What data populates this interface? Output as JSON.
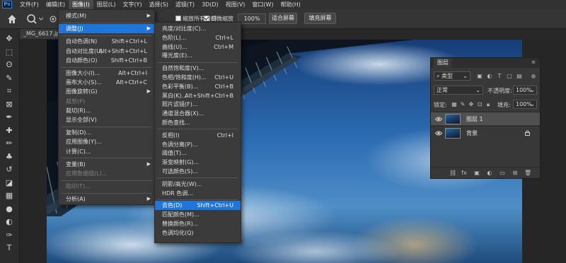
{
  "app": {
    "logo_text": "Ps"
  },
  "menubar": {
    "items": [
      "文件(F)",
      "编辑(E)",
      "图像(I)",
      "图层(L)",
      "文字(Y)",
      "选择(S)",
      "滤镜(T)",
      "3D(D)",
      "视图(V)",
      "窗口(W)",
      "帮助(H)"
    ],
    "active_index": 2
  },
  "options": {
    "resize_windows_label": "缩放所有窗口",
    "scrubby_zoom_label": "细微缩放",
    "zoom_value": "100%",
    "fit_screen_label": "适合屏幕",
    "fill_screen_label": "填充屏幕",
    "resize_windows_checked": false,
    "scrubby_zoom_checked": true
  },
  "document": {
    "tab_title": "_MG_6617.jpg"
  },
  "toolbar": {
    "icons": [
      "move-icon",
      "marquee-icon",
      "lasso-icon",
      "quick-select-icon",
      "crop-icon",
      "frame-icon",
      "eyedropper-icon",
      "healing-brush-icon",
      "brush-icon",
      "clone-stamp-icon",
      "history-brush-icon",
      "eraser-icon",
      "gradient-icon",
      "blur-icon",
      "dodge-icon",
      "pen-icon",
      "type-icon"
    ],
    "glyphs": [
      "✥",
      "⬚",
      "ʘ",
      "✎",
      "⌗",
      "⊠",
      "✒",
      "✚",
      "✏",
      "♣",
      "↺",
      "◪",
      "▦",
      "●",
      "◐",
      "✑",
      "T"
    ]
  },
  "image_menu": {
    "items": [
      {
        "label": "模式(M)",
        "shortcut": "",
        "submenu": true,
        "disabled": false
      },
      {
        "sep": true
      },
      {
        "label": "调整(J)",
        "shortcut": "",
        "submenu": true,
        "disabled": false,
        "highlight": true
      },
      {
        "sep": true
      },
      {
        "label": "自动色调(N)",
        "shortcut": "Shift+Ctrl+L",
        "disabled": false
      },
      {
        "label": "自动对比度(U)",
        "shortcut": "Alt+Shift+Ctrl+L",
        "disabled": false
      },
      {
        "label": "自动颜色(O)",
        "shortcut": "Shift+Ctrl+B",
        "disabled": false
      },
      {
        "sep": true
      },
      {
        "label": "图像大小(I)...",
        "shortcut": "Alt+Ctrl+I",
        "disabled": false
      },
      {
        "label": "画布大小(S)...",
        "shortcut": "Alt+Ctrl+C",
        "disabled": false
      },
      {
        "label": "图像旋转(G)",
        "shortcut": "",
        "submenu": true,
        "disabled": false
      },
      {
        "label": "裁剪(P)",
        "shortcut": "",
        "disabled": true
      },
      {
        "label": "裁切(R)...",
        "shortcut": "",
        "disabled": false
      },
      {
        "label": "显示全部(V)",
        "shortcut": "",
        "disabled": false
      },
      {
        "sep": true
      },
      {
        "label": "复制(D)...",
        "shortcut": "",
        "disabled": false
      },
      {
        "label": "应用图像(Y)...",
        "shortcut": "",
        "disabled": false
      },
      {
        "label": "计算(C)...",
        "shortcut": "",
        "disabled": false
      },
      {
        "sep": true
      },
      {
        "label": "变量(B)",
        "shortcut": "",
        "submenu": true,
        "disabled": false
      },
      {
        "label": "应用数据组(L)...",
        "shortcut": "",
        "disabled": true
      },
      {
        "sep": true
      },
      {
        "label": "陷印(T)...",
        "shortcut": "",
        "disabled": true
      },
      {
        "sep": true
      },
      {
        "label": "分析(A)",
        "shortcut": "",
        "submenu": true,
        "disabled": false
      }
    ]
  },
  "adjust_menu": {
    "items": [
      {
        "label": "亮度/对比度(C)...",
        "shortcut": ""
      },
      {
        "label": "色阶(L)...",
        "shortcut": "Ctrl+L"
      },
      {
        "label": "曲线(U)...",
        "shortcut": "Ctrl+M"
      },
      {
        "label": "曝光度(E)...",
        "shortcut": ""
      },
      {
        "sep": true
      },
      {
        "label": "自然饱和度(V)...",
        "shortcut": ""
      },
      {
        "label": "色相/饱和度(H)...",
        "shortcut": "Ctrl+U"
      },
      {
        "label": "色彩平衡(B)...",
        "shortcut": "Ctrl+B"
      },
      {
        "label": "黑白(K)...",
        "shortcut": "Alt+Shift+Ctrl+B"
      },
      {
        "label": "照片滤镜(F)...",
        "shortcut": ""
      },
      {
        "label": "通道混合器(X)...",
        "shortcut": ""
      },
      {
        "label": "颜色查找...",
        "shortcut": ""
      },
      {
        "sep": true
      },
      {
        "label": "反相(I)",
        "shortcut": "Ctrl+I"
      },
      {
        "label": "色调分离(P)...",
        "shortcut": ""
      },
      {
        "label": "阈值(T)...",
        "shortcut": ""
      },
      {
        "label": "渐变映射(G)...",
        "shortcut": ""
      },
      {
        "label": "可选颜色(S)...",
        "shortcut": ""
      },
      {
        "sep": true
      },
      {
        "label": "阴影/高光(W)...",
        "shortcut": ""
      },
      {
        "label": "HDR 色调...",
        "shortcut": ""
      },
      {
        "sep": true
      },
      {
        "label": "去色(D)",
        "shortcut": "Shift+Ctrl+U",
        "highlight": true
      },
      {
        "label": "匹配颜色(M)...",
        "shortcut": ""
      },
      {
        "label": "替换颜色(R)...",
        "shortcut": ""
      },
      {
        "label": "色调均化(Q)",
        "shortcut": ""
      }
    ]
  },
  "layers_panel": {
    "tab_label": "图层",
    "filter_kind": "类型",
    "blend_mode": "正常",
    "opacity_label": "不透明度:",
    "opacity_value": "100%",
    "lock_label": "锁定:",
    "fill_label": "填充:",
    "fill_value": "100%",
    "layers": [
      {
        "name": "图层 1",
        "selected": true,
        "locked": false
      },
      {
        "name": "背景",
        "selected": false,
        "locked": true
      }
    ],
    "footer_icons": [
      "link-layers-icon",
      "fx-icon",
      "mask-icon",
      "adjustment-icon",
      "group-icon",
      "new-layer-icon",
      "delete-icon"
    ]
  },
  "colors": {
    "accent": "#1f75d9",
    "panel": "#383838",
    "menubar": "#323232"
  }
}
